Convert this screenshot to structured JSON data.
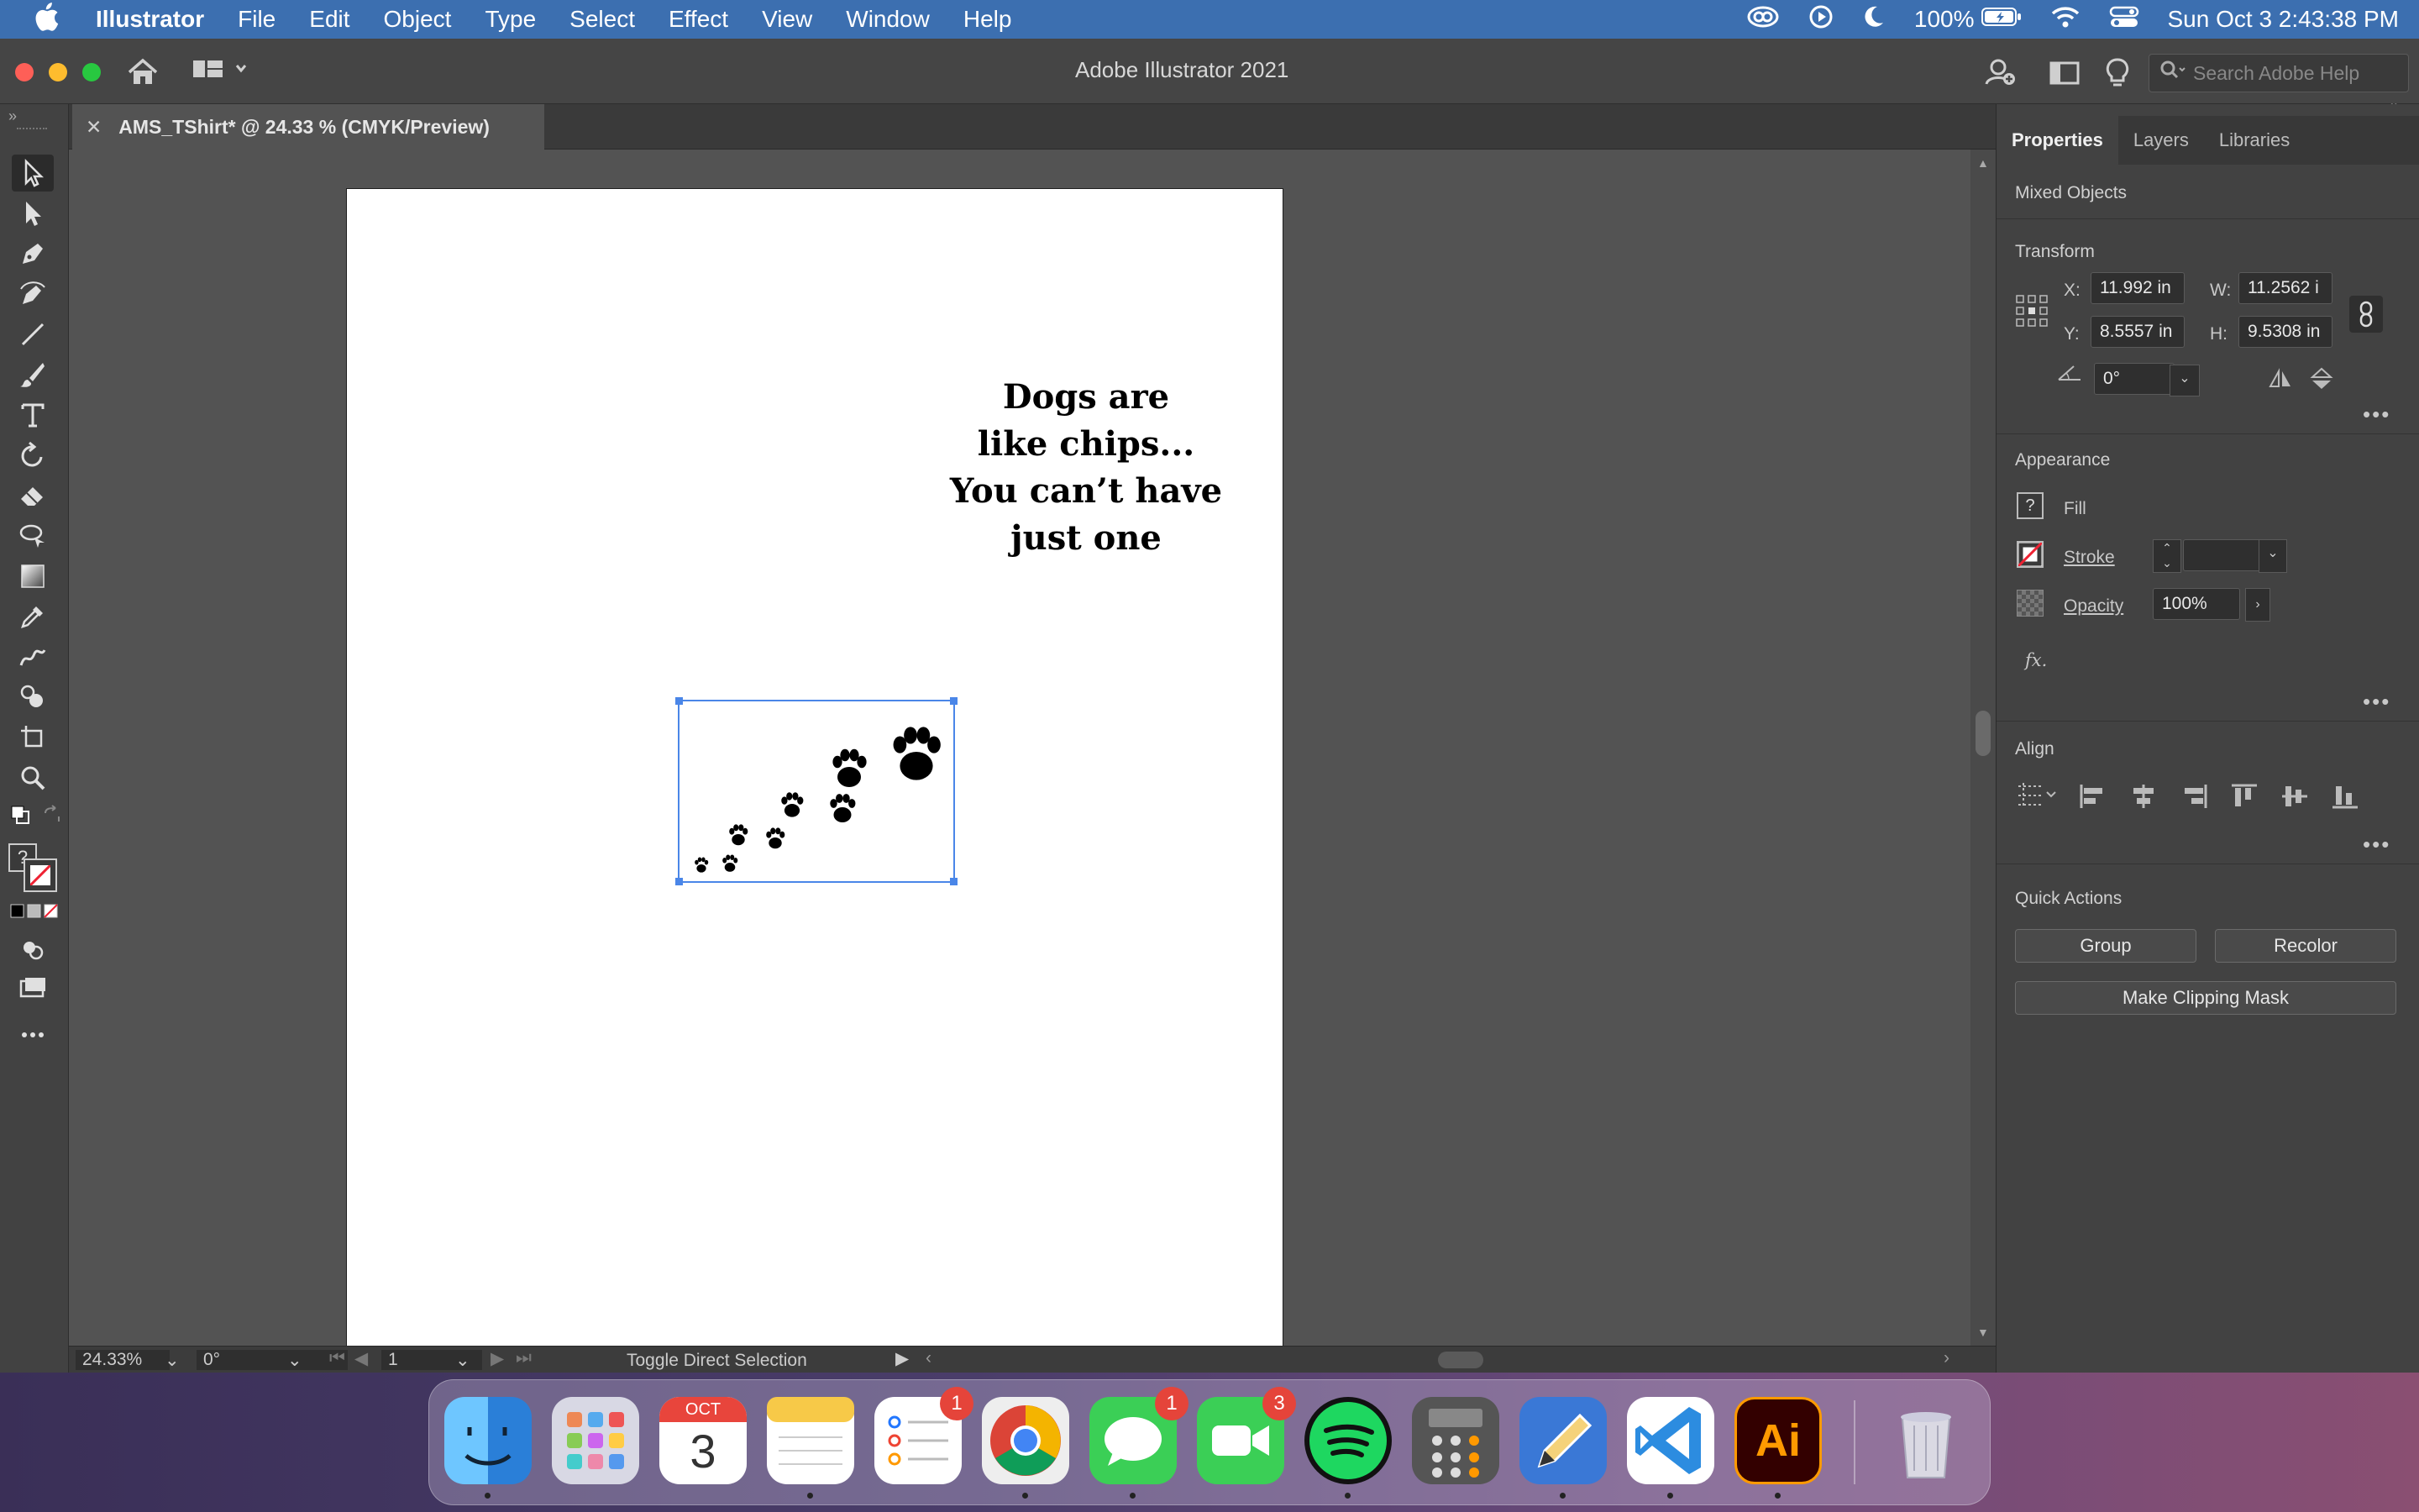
{
  "menubar": {
    "app_name": "Illustrator",
    "items": [
      "File",
      "Edit",
      "Object",
      "Type",
      "Select",
      "Effect",
      "View",
      "Window",
      "Help"
    ],
    "battery": "100%",
    "clock": "Sun Oct 3  2:43:38 PM"
  },
  "titlebar": {
    "title": "Adobe Illustrator 2021",
    "search_placeholder": "Search Adobe Help"
  },
  "document": {
    "tab_title": "AMS_TShirt* @ 24.33 % (CMYK/Preview)",
    "tagline_lines": [
      "Dogs are",
      "like chips...",
      "You can’t have",
      "just one"
    ]
  },
  "statusbar": {
    "zoom": "24.33%",
    "rotation": "0°",
    "artboard": "1",
    "tool_hint": "Toggle Direct Selection"
  },
  "panel": {
    "tabs": [
      "Properties",
      "Layers",
      "Libraries"
    ],
    "selection_type": "Mixed Objects",
    "transform": {
      "heading": "Transform",
      "x_label": "X:",
      "x": "11.992 in",
      "y_label": "Y:",
      "y": "8.5557 in",
      "w_label": "W:",
      "w": "11.2562 i",
      "h_label": "H:",
      "h": "9.5308 in",
      "angle": "0°"
    },
    "appearance": {
      "heading": "Appearance",
      "fill_label": "Fill",
      "stroke_label": "Stroke",
      "opacity_label": "Opacity",
      "opacity": "100%",
      "fx_label": "fx."
    },
    "align": {
      "heading": "Align"
    },
    "quick_actions": {
      "heading": "Quick Actions",
      "group": "Group",
      "recolor": "Recolor",
      "clipping_mask": "Make Clipping Mask"
    }
  },
  "dock": {
    "calendar_month": "OCT",
    "calendar_day": "3",
    "reminders_badge": "1",
    "messages_badge": "1",
    "facetime_badge": "3",
    "illustrator_label": "Ai"
  },
  "colors": {
    "menubar": "#3c6fb0",
    "selection": "#4a86e8",
    "panel_bg": "#424242",
    "canvas_bg": "#535353"
  }
}
